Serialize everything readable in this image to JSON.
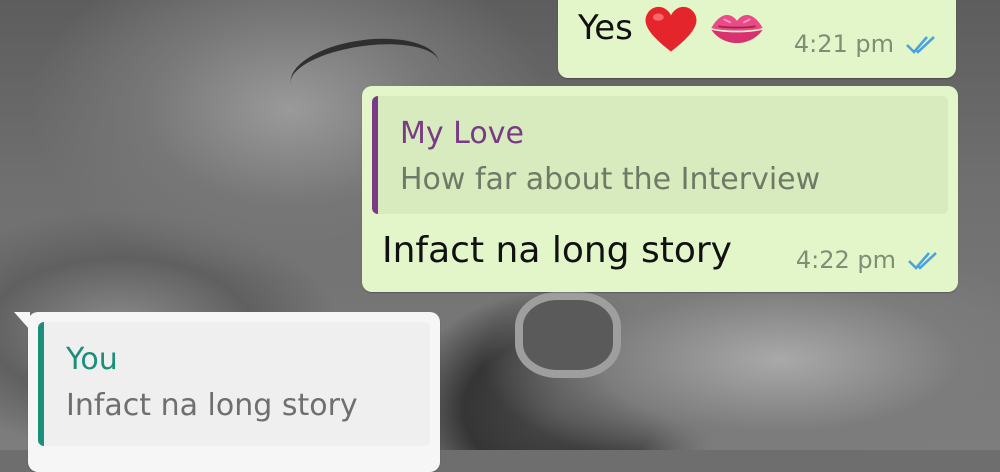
{
  "messages": [
    {
      "id": "yes",
      "text": "Yes",
      "emojis": [
        "red-heart-icon",
        "kiss-mark-icon"
      ],
      "time": "4:21 pm",
      "status": "read-double-tick"
    },
    {
      "id": "infact",
      "quote": {
        "author": "My Love",
        "text": "How far about the Interview"
      },
      "text": "Infact na long story",
      "time": "4:22 pm",
      "status": "read-double-tick"
    },
    {
      "id": "you",
      "quote": {
        "author": "You",
        "text": "Infact na long story"
      }
    }
  ],
  "colors": {
    "outgoing_bubble": "#e2f6c9",
    "incoming_bubble": "#f6f6f6",
    "quote_author_purple": "#7a3b86",
    "quote_author_teal": "#1b8f7a",
    "tick_blue": "#4aa3df"
  }
}
